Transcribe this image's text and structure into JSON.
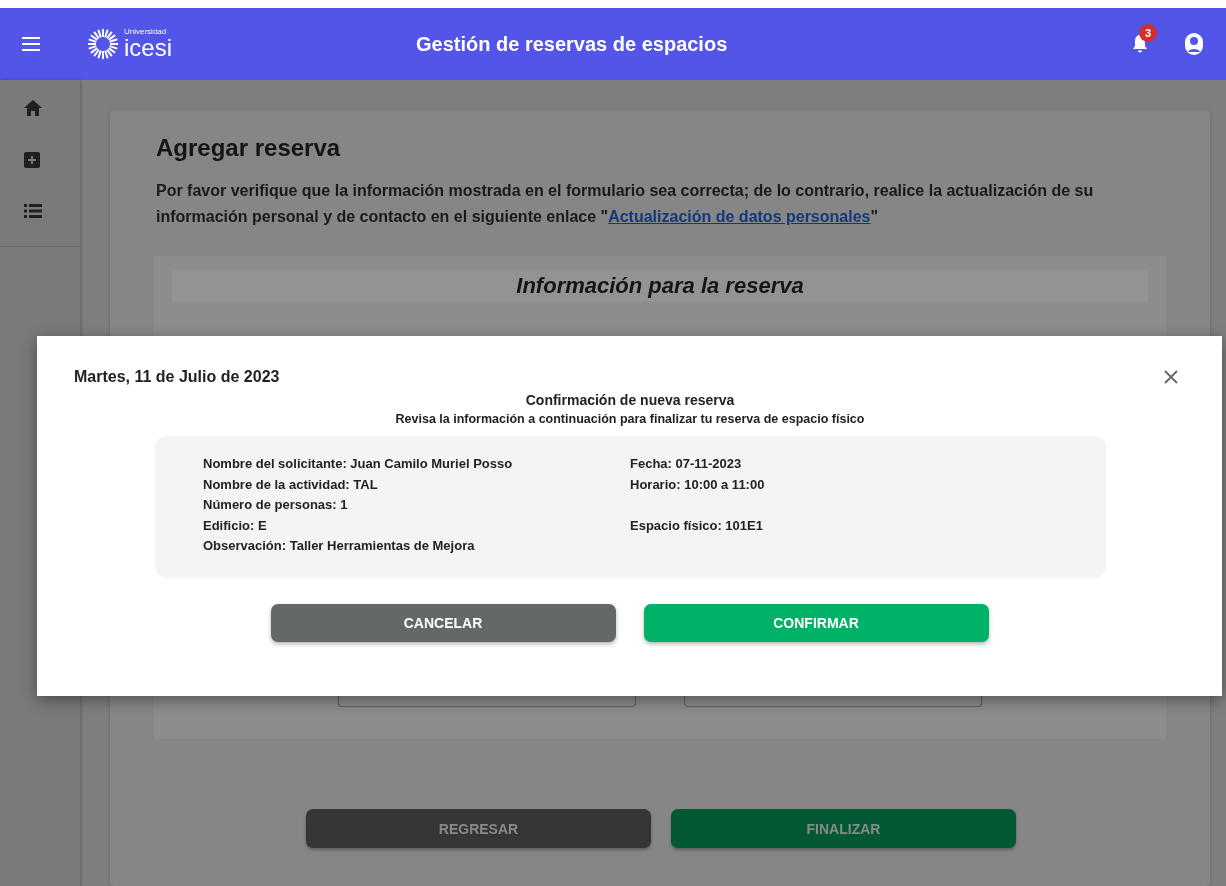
{
  "header": {
    "title": "Gestión de reservas de espacios",
    "logo_small": "Universidad",
    "logo": "icesi",
    "notification_count": "3"
  },
  "sidebar": {
    "items": [
      {
        "kind": "home"
      },
      {
        "kind": "add"
      },
      {
        "kind": "list"
      }
    ]
  },
  "page": {
    "title": "Agregar reserva",
    "intro": "Por favor verifique que la información mostrada en el formulario sea correcta; de lo contrario, realice la actualización de su información personal y de contacto en el siguiente enlace \"",
    "link": "Actualización de datos personales",
    "intro_end": "\"",
    "section_title": "Información para la reserva",
    "buttons": [
      {
        "label": "REGRESAR",
        "kind": "back"
      },
      {
        "label": "FINALIZAR",
        "kind": "finish"
      }
    ]
  },
  "dialog": {
    "date": "Martes, 11 de Julio de 2023",
    "title": "Confirmación de nueva reserva",
    "subtitle": "Revisa la información a continuación para finalizar tu reserva de espacio físico",
    "rows": [
      {
        "left": "Nombre del solicitante: Juan Camilo Muriel Posso",
        "right": "Fecha: 07-11-2023"
      },
      {
        "left": "Nombre de la actividad: TAL",
        "right": "Horario: 10:00 a 11:00"
      },
      {
        "left": "Número de personas: 1"
      },
      {
        "left": "Edificio: E",
        "right": "Espacio físico: 101E1"
      },
      {
        "left": "Observación: Taller Herramientas de Mejora"
      }
    ],
    "buttons": [
      {
        "label": "CANCELAR",
        "kind": "cancel"
      },
      {
        "label": "CONFIRMAR",
        "kind": "confirm"
      }
    ]
  }
}
